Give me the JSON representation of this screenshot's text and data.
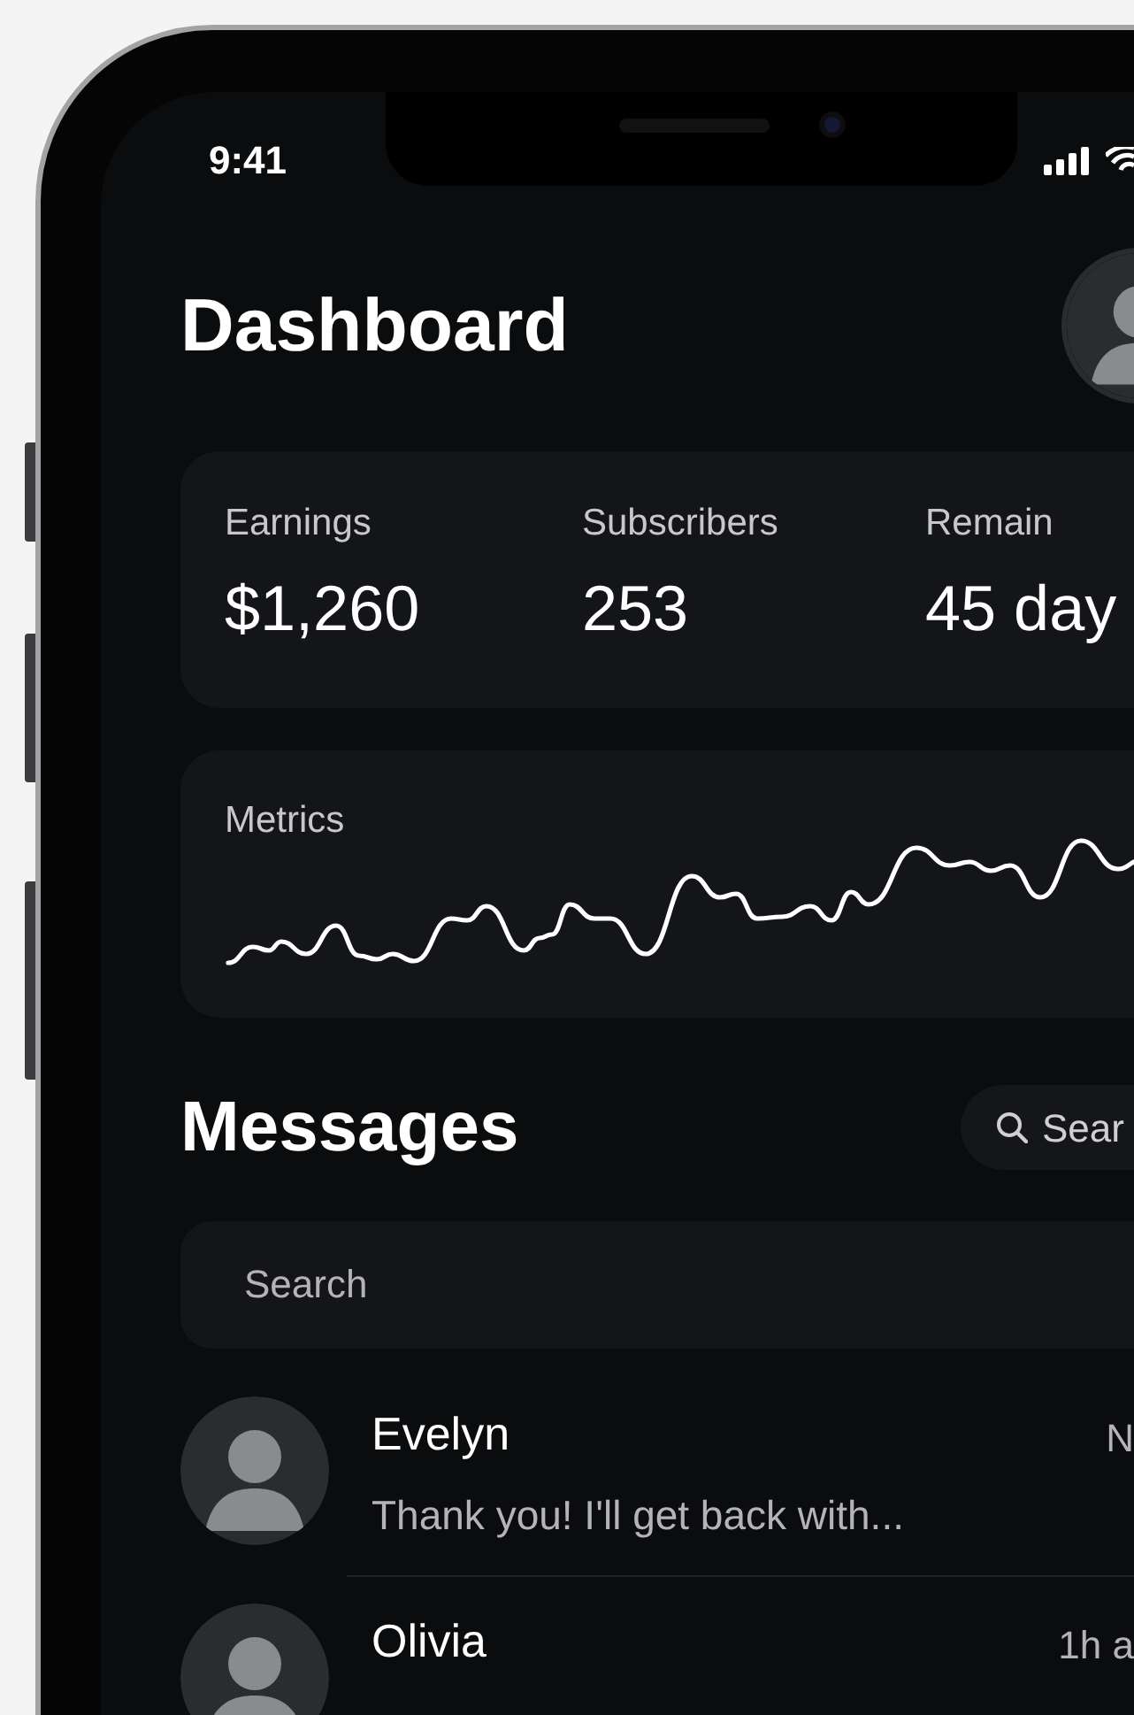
{
  "status_bar": {
    "time": "9:41"
  },
  "header": {
    "title": "Dashboard"
  },
  "stats": [
    {
      "label": "Earnings",
      "value": "$1,260"
    },
    {
      "label": "Subscribers",
      "value": "253"
    },
    {
      "label": "Remain",
      "value": "45 day"
    }
  ],
  "metrics": {
    "title": "Metrics"
  },
  "messages": {
    "title": "Messages",
    "search_button": "Sear",
    "search_field": {
      "placeholder": "Search"
    },
    "items": [
      {
        "name": "Evelyn",
        "preview": "Thank you! I'll get back with...",
        "time": "N"
      },
      {
        "name": "Olivia",
        "time": "1h a"
      }
    ]
  }
}
